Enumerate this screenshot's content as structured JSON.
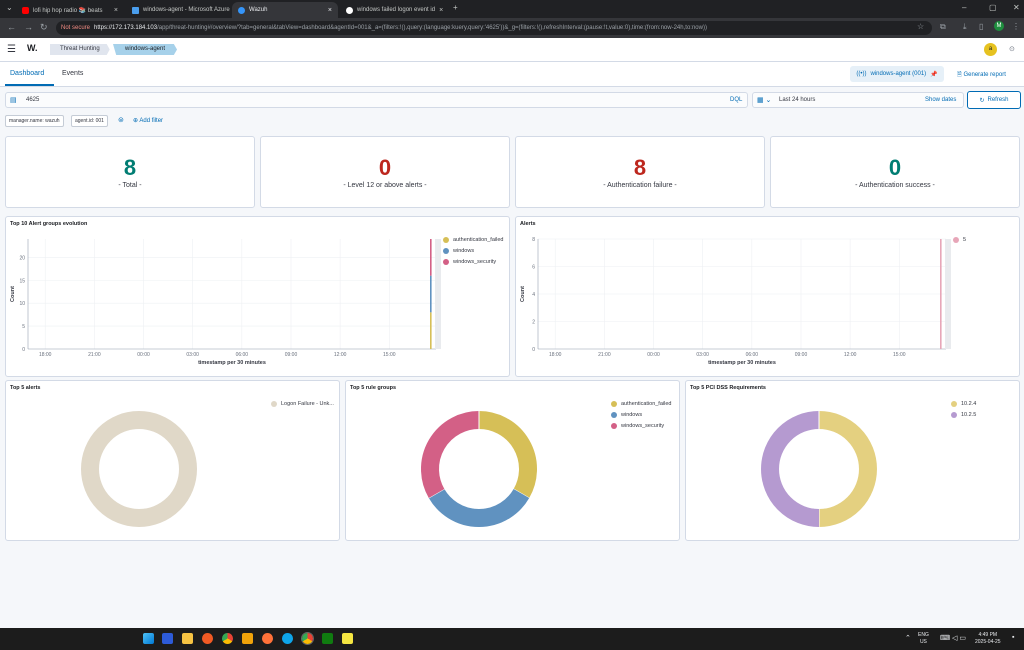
{
  "browser": {
    "tabs": [
      {
        "title": "lofi hip hop radio 📚 beats",
        "fav_color": "#ff0000"
      },
      {
        "title": "windows-agent - Microsoft Azure",
        "fav_color": "#4a9eed"
      },
      {
        "title": "Wazuh",
        "fav_color": "#3595f9"
      },
      {
        "title": "windows failed logon event id",
        "fav_color": "#ffffff"
      }
    ],
    "not_secure": "Not secure",
    "url_host": "https://172.173.184.103",
    "url_path": "/app/threat-hunting#/overview/?tab=general&tabView=dashboard&agentId=001&_a=(filters:!(),query:(language:kuery,query:'4625'))&_g=(filters:!(),refreshInterval:(pause:!t,value:0),time:(from:now-24h,to:now))",
    "profile_initial": "M"
  },
  "header": {
    "logo": "W.",
    "crumb1": "Threat Hunting",
    "crumb2": "windows-agent",
    "avatar": "a"
  },
  "subnav": {
    "tab_dashboard": "Dashboard",
    "tab_events": "Events",
    "agent_button": "windows-agent (001)",
    "generate_report": "Generate report"
  },
  "query": {
    "value": "4625",
    "dql": "DQL",
    "time_range": "Last 24 hours",
    "show_dates": "Show dates",
    "refresh": "Refresh"
  },
  "filters": {
    "pills": [
      "manager.name: wazuh",
      "agent.id: 001"
    ],
    "add_filter": "Add filter"
  },
  "stats": [
    {
      "value": "8",
      "label": "- Total -",
      "color": "#017d73"
    },
    {
      "value": "0",
      "label": "- Level 12 or above alerts -",
      "color": "#bd271e"
    },
    {
      "value": "8",
      "label": "- Authentication failure -",
      "color": "#bd271e"
    },
    {
      "value": "0",
      "label": "- Authentication success -",
      "color": "#017d73"
    }
  ],
  "panels": {
    "evolution_title": "Top 10 Alert groups evolution",
    "alerts_title": "Alerts",
    "top5_alerts_title": "Top 5 alerts",
    "top5_rule_groups_title": "Top 5 rule groups",
    "top5_pci_title": "Top 5 PCI DSS Requirements"
  },
  "chart_data": [
    {
      "type": "bar",
      "title": "Top 10 Alert groups evolution",
      "xlabel": "timestamp per 30 minutes",
      "ylabel": "Count",
      "x_ticks": [
        "18:00",
        "21:00",
        "00:00",
        "03:00",
        "06:00",
        "09:00",
        "12:00",
        "15:00"
      ],
      "y_ticks": [
        0,
        5,
        10,
        15,
        20
      ],
      "ylim": [
        0,
        24
      ],
      "series": [
        {
          "name": "authentication_failed",
          "color": "#d6bf57",
          "values": [
            8
          ]
        },
        {
          "name": "windows",
          "color": "#6092c0",
          "values": [
            8
          ]
        },
        {
          "name": "windows_security",
          "color": "#d36086",
          "values": [
            8
          ]
        }
      ],
      "legend": "top-right",
      "grid": true
    },
    {
      "type": "bar",
      "title": "Alerts",
      "xlabel": "timestamp per 30 minutes",
      "ylabel": "Count",
      "x_ticks": [
        "18:00",
        "21:00",
        "00:00",
        "03:00",
        "06:00",
        "09:00",
        "12:00",
        "15:00"
      ],
      "y_ticks": [
        0,
        2,
        4,
        6,
        8
      ],
      "ylim": [
        0,
        8
      ],
      "series": [
        {
          "name": "5",
          "color": "#e7a6b8",
          "values": [
            8
          ]
        }
      ],
      "legend": "top-right",
      "grid": true
    },
    {
      "type": "pie",
      "title": "Top 5 alerts",
      "series": [
        {
          "name": "Logon Failure - Unk...",
          "color": "#e0d8c8",
          "value": 8
        }
      ]
    },
    {
      "type": "pie",
      "title": "Top 5 rule groups",
      "series": [
        {
          "name": "authentication_failed",
          "color": "#d6bf57",
          "value": 8
        },
        {
          "name": "windows",
          "color": "#6092c0",
          "value": 8
        },
        {
          "name": "windows_security",
          "color": "#d36086",
          "value": 8
        }
      ]
    },
    {
      "type": "pie",
      "title": "Top 5 PCI DSS Requirements",
      "series": [
        {
          "name": "10.2.4",
          "color": "#e4d080",
          "value": 8
        },
        {
          "name": "10.2.5",
          "color": "#b59ad0",
          "value": 8
        }
      ]
    }
  ],
  "taskbar": {
    "lang1": "ENG",
    "lang2": "US",
    "time": "4:49 PM",
    "date": "2025-04-25"
  }
}
